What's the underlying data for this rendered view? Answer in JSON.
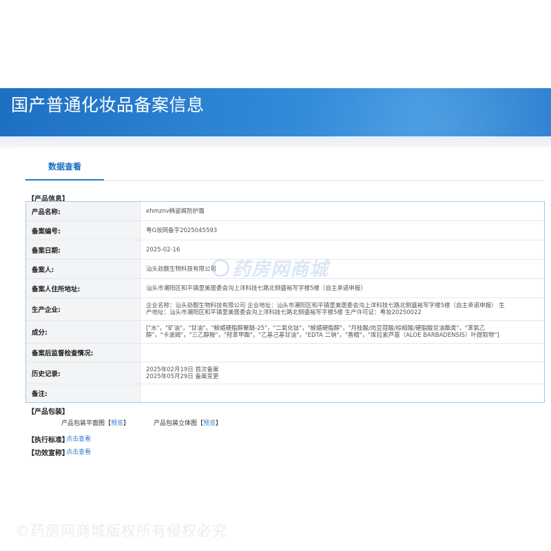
{
  "banner": {
    "title": "国产普通化妆品备案信息"
  },
  "tab": {
    "label": "数据查看"
  },
  "sections": {
    "product_info": "【产品信息】",
    "packaging": "【产品包装】",
    "standard": "【执行标准】",
    "efficacy": "【功效宣称】"
  },
  "product_rows": [
    {
      "label": "产品名称:",
      "value": "ehmznv韩姿娓防护霜"
    },
    {
      "label": "备案编号:",
      "value": "粤G妆网备字2025045593"
    },
    {
      "label": "备案日期:",
      "value": "2025-02-16"
    },
    {
      "label": "备案人:",
      "value": "汕头劲靓生物科技有限公司"
    },
    {
      "label": "备案人住所地址:",
      "value": "汕头市潮阳区和平镇里美居委会沟上洋科技七路北侧盛裕写字楼5楼（自主承诺申报）"
    },
    {
      "label": "生产企业:",
      "value": "企业名称：汕头劲靓生物科技有限公司 企业地址：汕头市潮阳区和平镇里美居委会沟上洋科技七路北侧盛裕写字楼5楼（自主承诺申报） 生\n产地址：汕头市潮阳区和平镇里美居委会沟上洋科技七路北侧盛裕写字楼5楼 生产许可证：粤妆20250022"
    },
    {
      "label": "成分:",
      "value": "[\"水\"，\"矿油\"，\"甘油\"，\"鲸蜡硬脂醇聚醚-25\"，\"二氧化钛\"，\"鲸蜡硬脂醇\"，\"月桂酸/肉豆蔻酸/棕榈酸/硬脂酸甘油酯类\"，\"苯氧乙\n醇\"，\"卡波姆\"，\"三乙醇胺\"，\"羟苯甲酯\"，\"乙基己基甘油\"，\"EDTA 二钠\"，\"香精\"，\"库拉索芦荟（ALOE BARBADENSIS）叶提取物\"]"
    },
    {
      "label": "备案后监督检查情况:",
      "value": ""
    },
    {
      "label": "历史记录:",
      "value": "2025年02月19日 首次备案\n2025年05月29日 备案变更"
    },
    {
      "label": "备注:",
      "value": ""
    }
  ],
  "packaging": {
    "flat_label": "产品包装平面图",
    "flat_link": "预览",
    "solid_label": "产品包装立体图",
    "solid_link": "预览"
  },
  "standard_link": "点击查看",
  "efficacy_link": "点击查看",
  "watermarks": {
    "center": "药房网商城",
    "bottom": "©药房网商城版权所有侵权必究"
  },
  "colors": {
    "banner": "#2a7fd0",
    "accent": "#2c7fd2",
    "table_border": "#9ec8ec"
  }
}
